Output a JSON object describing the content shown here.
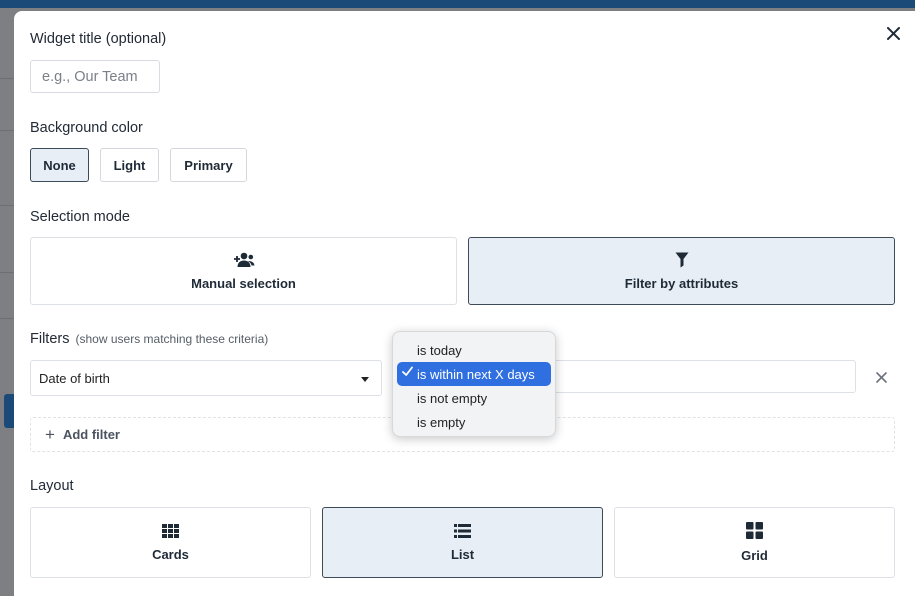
{
  "modal": {
    "close_icon": "close-icon",
    "widget_title": {
      "label": "Widget title (optional)",
      "placeholder": "e.g., Our Team",
      "value": ""
    },
    "background_color": {
      "label": "Background color",
      "options": [
        "None",
        "Light",
        "Primary"
      ],
      "selected": "None"
    },
    "selection_mode": {
      "label": "Selection mode",
      "options": [
        {
          "label": "Manual selection",
          "icon": "user-plus-icon",
          "selected": false
        },
        {
          "label": "Filter by attributes",
          "icon": "filter-icon",
          "selected": true
        }
      ]
    },
    "filters": {
      "label": "Filters",
      "hint": "(show users matching these criteria)",
      "rows": [
        {
          "attribute": "Date of birth",
          "operator": "is within next X days",
          "value": ""
        }
      ],
      "add_label": "Add filter",
      "remove_icon": "close-icon"
    },
    "operator_dropdown": {
      "options": [
        "is today",
        "is within next X days",
        "is not empty",
        "is empty"
      ],
      "selected": "is within next X days"
    },
    "layout": {
      "label": "Layout",
      "options": [
        {
          "label": "Cards",
          "icon": "cards-grid-icon",
          "selected": false
        },
        {
          "label": "List",
          "icon": "list-icon",
          "selected": true
        },
        {
          "label": "Grid",
          "icon": "grid-icon",
          "selected": false
        }
      ]
    }
  },
  "colors": {
    "selected_bg": "#e8eef5",
    "selected_border": "#3d4a57",
    "dropdown_highlight": "#2f6fe0",
    "brand_navy": "#1b4a78"
  }
}
